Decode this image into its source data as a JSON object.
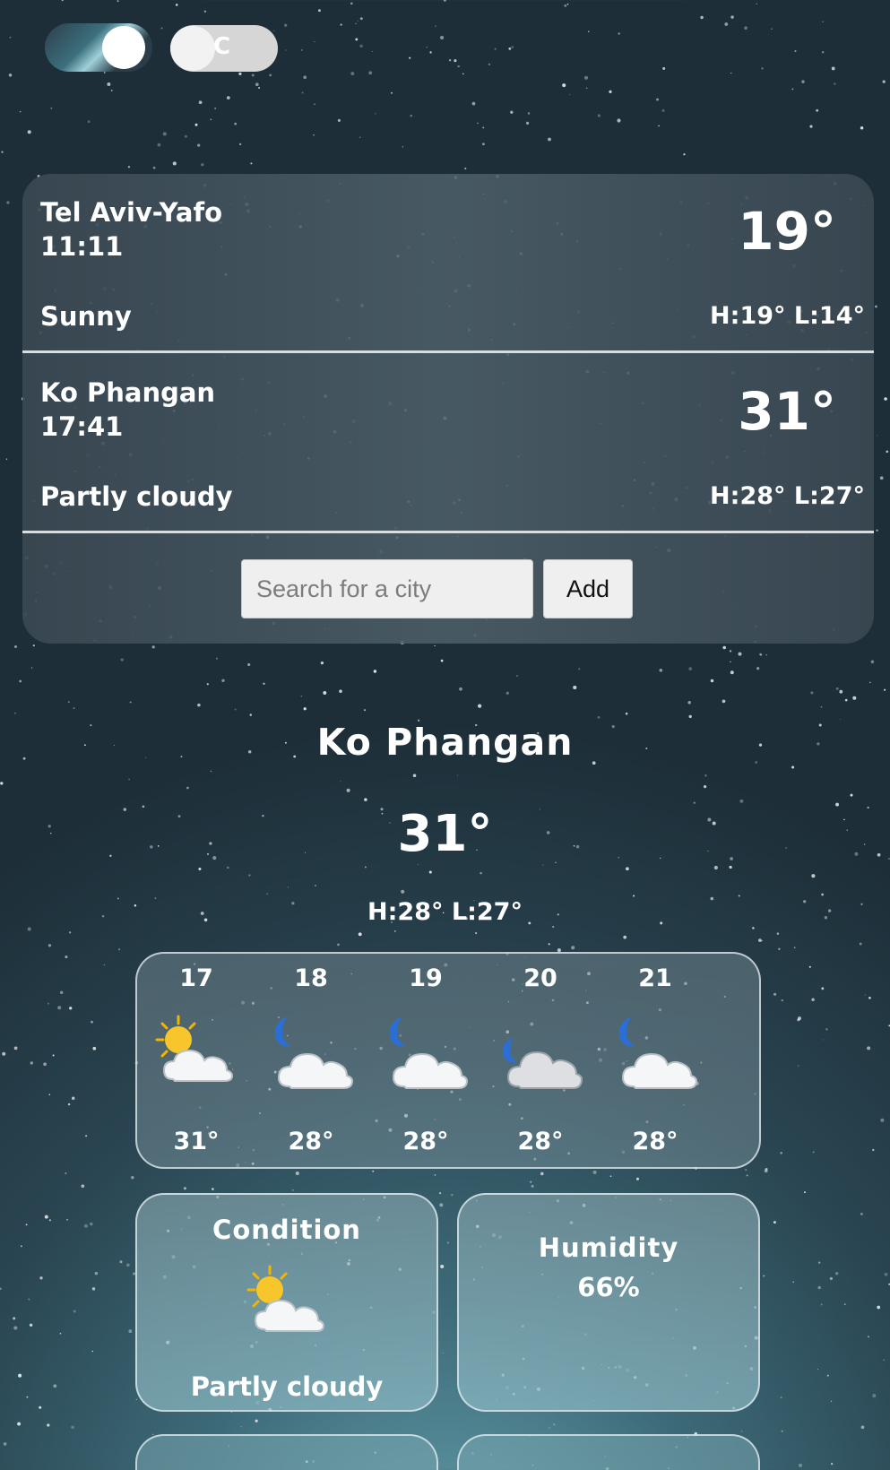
{
  "toggles": {
    "unit_label": "C"
  },
  "city_list": [
    {
      "name": "Tel Aviv-Yafo",
      "time": "11:11",
      "condition": "Sunny",
      "temp": "19°",
      "hl": "H:19° L:14°"
    },
    {
      "name": "Ko Phangan",
      "time": "17:41",
      "condition": "Partly cloudy",
      "temp": "31°",
      "hl": "H:28° L:27°"
    }
  ],
  "search": {
    "placeholder": "Search for a city",
    "add_label": "Add"
  },
  "current": {
    "city": "Ko Phangan",
    "temp": "31°",
    "hl": "H:28° L:27°"
  },
  "forecast": [
    {
      "day": "17",
      "icon": "sun-behind-cloud-icon",
      "temp": "31°"
    },
    {
      "day": "18",
      "icon": "moon-cloud-icon",
      "temp": "28°"
    },
    {
      "day": "19",
      "icon": "moon-cloud-icon",
      "temp": "28°"
    },
    {
      "day": "20",
      "icon": "moon-grey-cloud-icon",
      "temp": "28°"
    },
    {
      "day": "21",
      "icon": "moon-cloud-icon",
      "temp": "28°"
    }
  ],
  "cards": {
    "condition": {
      "title": "Condition",
      "value": "Partly cloudy",
      "icon": "sun-behind-cloud-icon"
    },
    "humidity": {
      "title": "Humidity",
      "value": "66%"
    }
  }
}
